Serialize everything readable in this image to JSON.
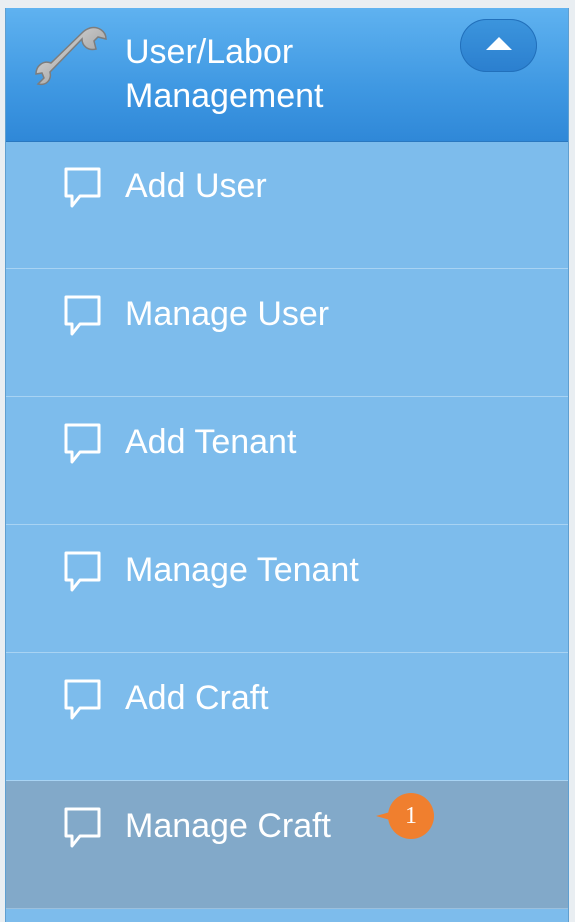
{
  "header": {
    "title": "User/Labor Management",
    "icon": "wrench-icon",
    "toggle_icon": "caret-up-icon"
  },
  "menu": {
    "items": [
      {
        "label": "Add User",
        "icon": "chat-bubble-icon",
        "active": false
      },
      {
        "label": "Manage User",
        "icon": "chat-bubble-icon",
        "active": false
      },
      {
        "label": "Add Tenant",
        "icon": "chat-bubble-icon",
        "active": false
      },
      {
        "label": "Manage Tenant",
        "icon": "chat-bubble-icon",
        "active": false
      },
      {
        "label": "Add Craft",
        "icon": "chat-bubble-icon",
        "active": false
      },
      {
        "label": "Manage Craft",
        "icon": "chat-bubble-icon",
        "active": true
      }
    ]
  },
  "annotation": {
    "number": "1",
    "color": "#f07f2e"
  },
  "colors": {
    "header_top": "#5fb2f0",
    "header_bottom": "#2f88d8",
    "menu_bg": "#7dbcec",
    "active_bg": "#82a9c9",
    "text": "#ffffff"
  }
}
